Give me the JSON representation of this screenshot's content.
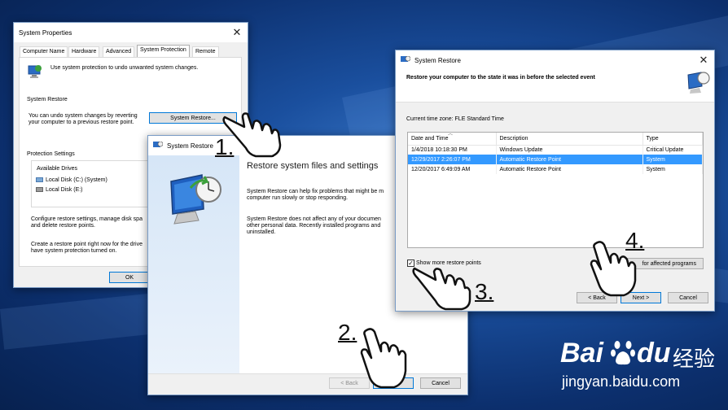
{
  "sys_props": {
    "title": "System Properties",
    "tabs": [
      "Computer Name",
      "Hardware",
      "Advanced",
      "System Protection",
      "Remote"
    ],
    "intro": "Use system protection to undo unwanted system changes.",
    "restore_heading": "System Restore",
    "restore_text_1": "You can undo system changes by reverting",
    "restore_text_2": "your computer to a previous restore point.",
    "restore_button": "System Restore...",
    "protection_heading": "Protection Settings",
    "drives_header": "Available Drives",
    "drives": [
      "Local Disk (C:) (System)",
      "Local Disk (E:)"
    ],
    "configure_1": "Configure restore settings, manage disk spa",
    "configure_2": "and delete restore points.",
    "create_1": "Create a restore point right now for the drive",
    "create_2": "have system protection turned on.",
    "ok_button": "OK"
  },
  "restore_wizard": {
    "title": "System Restore",
    "heading": "Restore system files and settings",
    "para1_1": "System Restore can help fix problems that might be m",
    "para1_2": "computer run slowly or stop responding.",
    "para2_1": "System Restore does not affect any of your documen",
    "para2_2": "other personal data. Recently installed programs and",
    "para2_3": "uninstalled.",
    "back_button": "< Back",
    "next_button": "Next >",
    "cancel_button": "Cancel"
  },
  "restore_points": {
    "title": "System Restore",
    "heading": "Restore your computer to the state it was in before the selected event",
    "timezone": "Current time zone: FLE Standard Time",
    "columns": [
      "Date and Time",
      "Description",
      "Type"
    ],
    "rows": [
      {
        "date": "1/4/2018 10:18:30 PM",
        "desc": "Windows Update",
        "type": "Critical Update"
      },
      {
        "date": "12/29/2017 2:26:07 PM",
        "desc": "Automatic Restore Point",
        "type": "System"
      },
      {
        "date": "12/20/2017 6:49:09 AM",
        "desc": "Automatic Restore Point",
        "type": "System"
      }
    ],
    "show_more": "Show more restore points",
    "scan_button": "for affected programs",
    "back_button": "< Back",
    "next_button": "Next >",
    "cancel_button": "Cancel"
  },
  "steps": [
    "1.",
    "2.",
    "3.",
    "4."
  ],
  "watermark": {
    "brand_1": "Bai",
    "brand_2": "du",
    "brand_cn": "经验",
    "url": "jingyan.baidu.com"
  },
  "colors": {
    "selection": "#3399ff",
    "accent_border": "#0078d7",
    "desktop": "#1a4f9e"
  }
}
